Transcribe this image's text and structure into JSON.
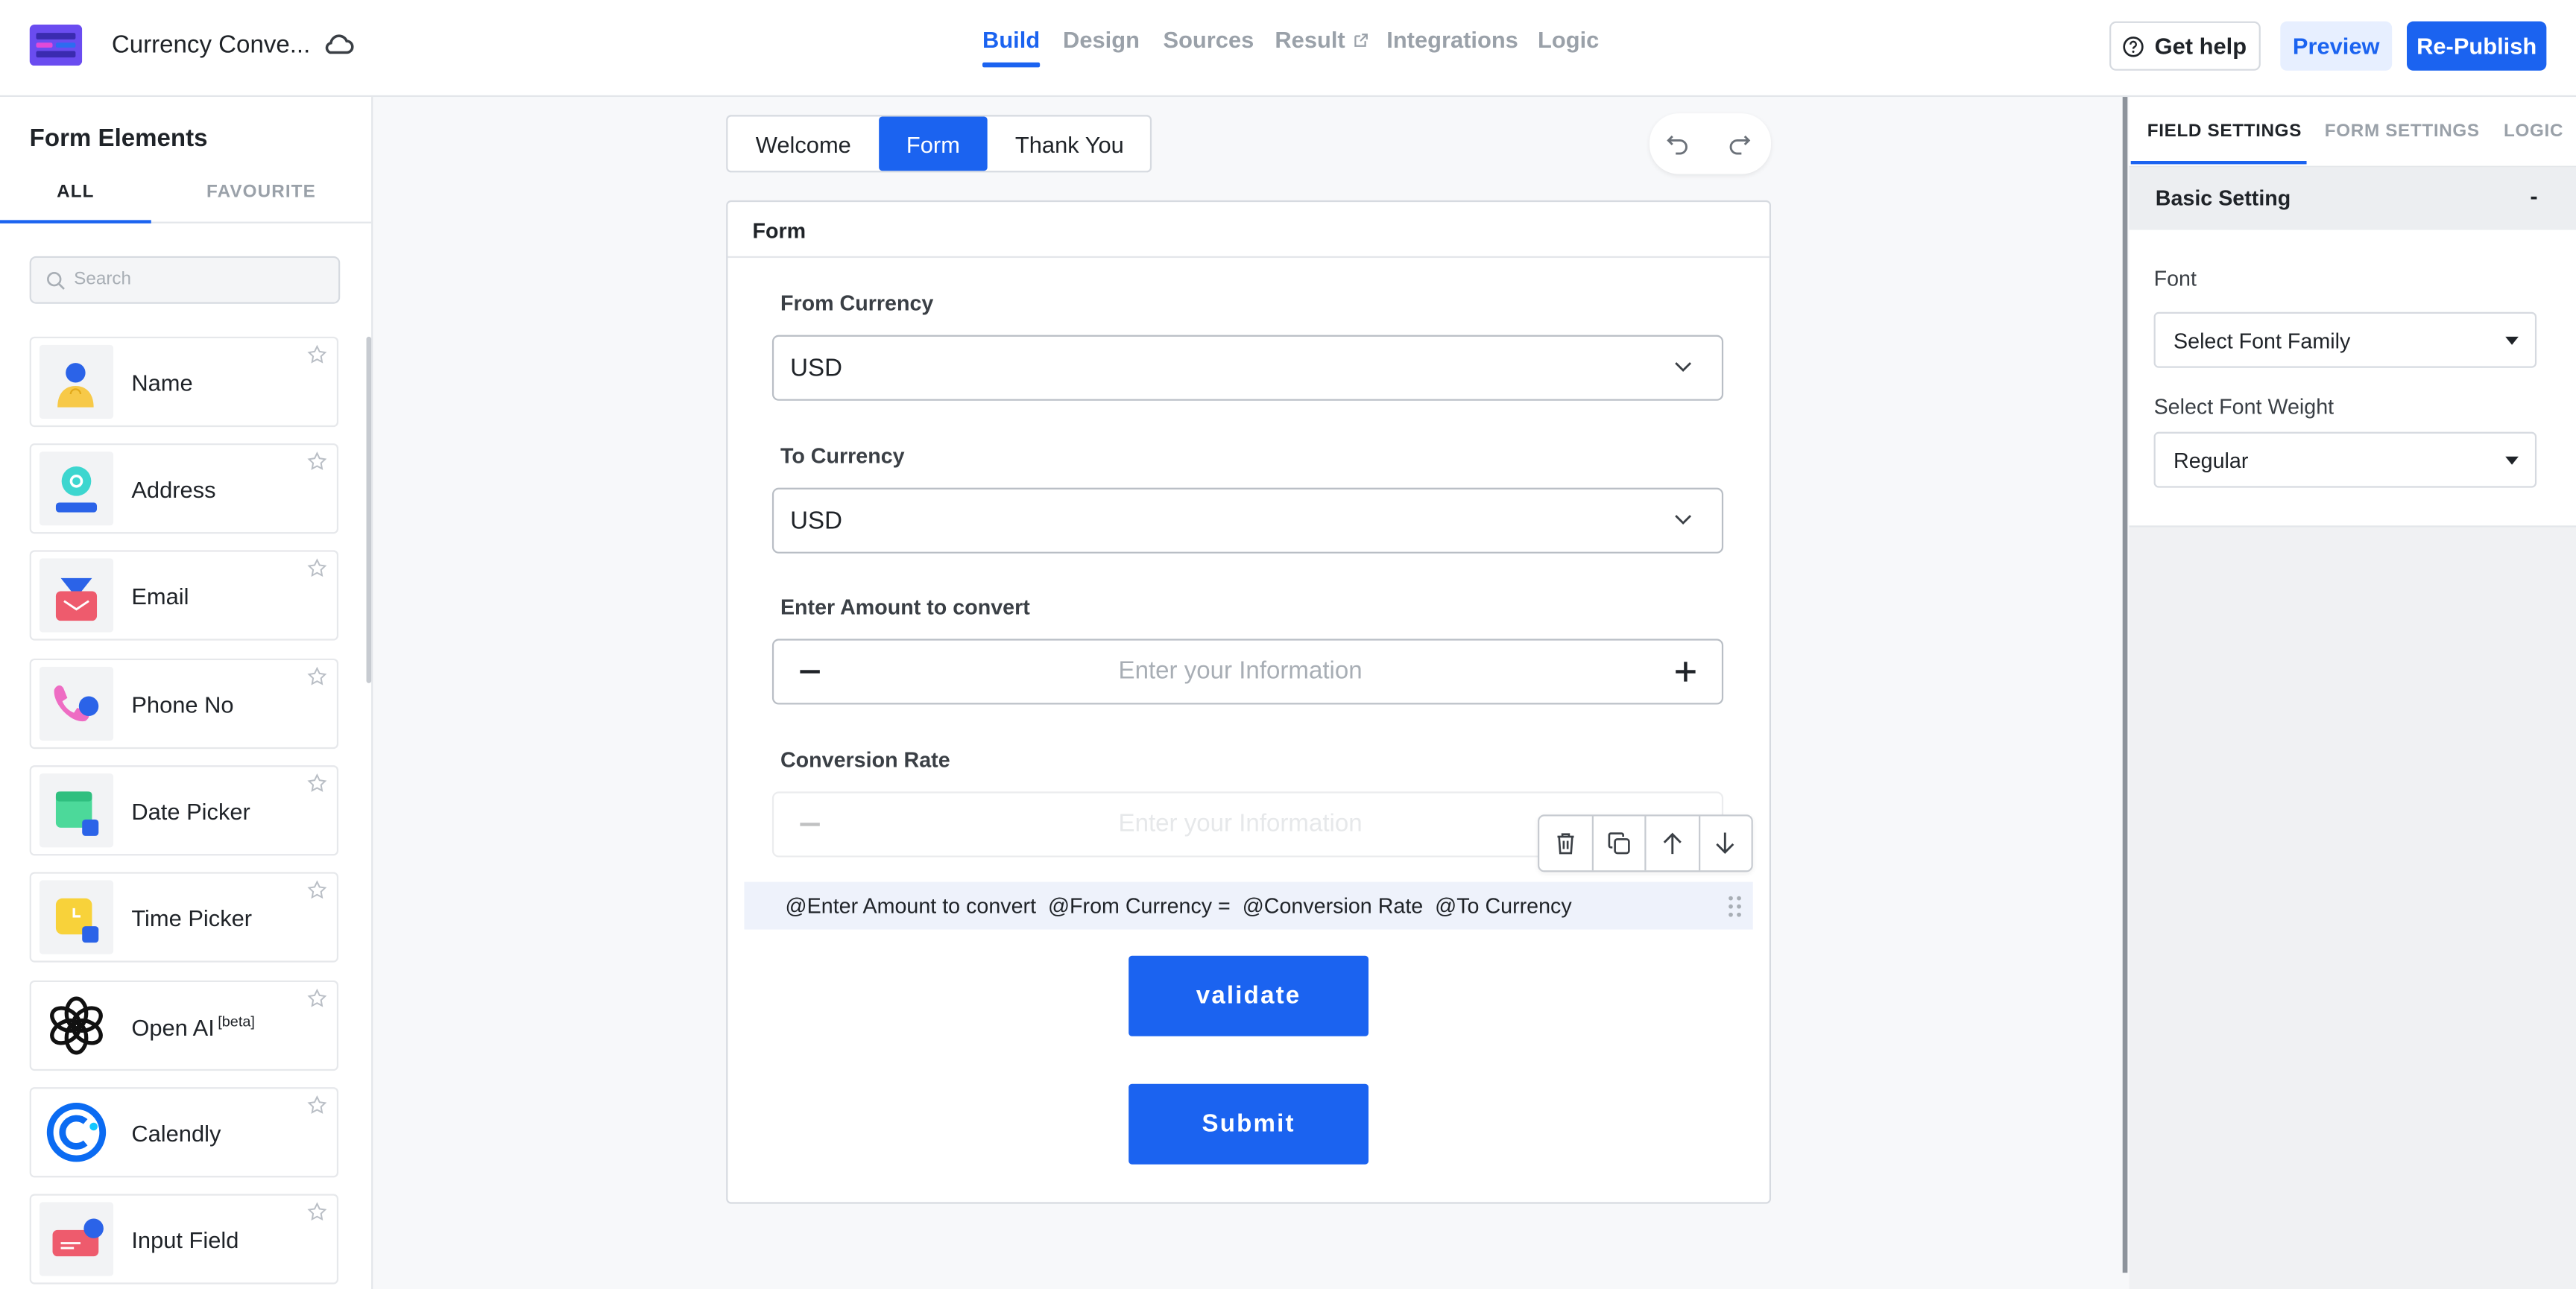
{
  "app": {
    "title": "Currency Conve..."
  },
  "nav": {
    "tabs": [
      {
        "label": "Build",
        "active": true
      },
      {
        "label": "Design"
      },
      {
        "label": "Sources"
      },
      {
        "label": "Result"
      },
      {
        "label": "Integrations"
      },
      {
        "label": "Logic"
      }
    ]
  },
  "header": {
    "help_label": "Get help",
    "preview_label": "Preview",
    "publish_label": "Re-Publish"
  },
  "sidebar": {
    "title": "Form Elements",
    "tabs": [
      "ALL",
      "FAVOURITE"
    ],
    "search_placeholder": "Search",
    "items": [
      {
        "label": "Name",
        "icon": "person-icon"
      },
      {
        "label": "Address",
        "icon": "location-icon"
      },
      {
        "label": "Email",
        "icon": "envelope-icon"
      },
      {
        "label": "Phone No",
        "icon": "phone-icon"
      },
      {
        "label": "Date Picker",
        "icon": "calendar-icon"
      },
      {
        "label": "Time Picker",
        "icon": "clock-icon"
      },
      {
        "label": "Open AI",
        "badge": "[beta]",
        "icon": "openai-icon"
      },
      {
        "label": "Calendly",
        "icon": "calendly-icon"
      },
      {
        "label": "Input Field",
        "icon": "input-field-icon"
      }
    ]
  },
  "canvas": {
    "page_tabs": [
      "Welcome",
      "Form",
      "Thank You"
    ],
    "active_page_tab": "Form",
    "form_title": "Form",
    "fields": {
      "from_currency": {
        "label": "From Currency",
        "value": "USD"
      },
      "to_currency": {
        "label": "To Currency",
        "value": "USD"
      },
      "amount": {
        "label": "Enter Amount to convert",
        "placeholder": "Enter your Information"
      },
      "rate": {
        "label": "Conversion Rate",
        "placeholder": "Enter your Information"
      }
    },
    "formula": "@Enter Amount to convert  @From Currency =  @Conversion Rate  @To Currency",
    "validate_label": "validate",
    "submit_label": "Submit"
  },
  "right_panel": {
    "tabs": [
      "FIELD SETTINGS",
      "FORM SETTINGS",
      "LOGIC"
    ],
    "section_title": "Basic Setting",
    "section_toggle": "-",
    "font_label": "Font",
    "font_value": "Select Font Family",
    "weight_label": "Select Font Weight",
    "weight_value": "Regular"
  },
  "colors": {
    "accent": "#1b63f0",
    "canvas_bg": "#f7f8fa"
  }
}
